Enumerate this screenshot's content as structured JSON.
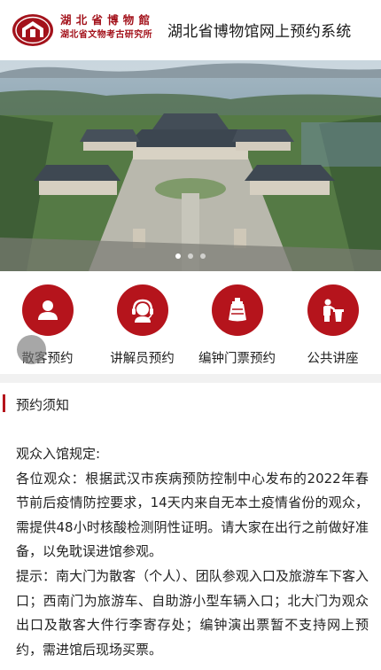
{
  "header": {
    "logo_line1": "湖北省博物館",
    "logo_line2": "湖北省文物考古研究所",
    "title": "湖北省博物馆网上预约系统"
  },
  "banner": {
    "slide_count": 3,
    "active_slide": 1
  },
  "menu": {
    "items": [
      {
        "label": "散客预约",
        "icon": "person-icon"
      },
      {
        "label": "讲解员预约",
        "icon": "headset-guide-icon"
      },
      {
        "label": "编钟门票预约",
        "icon": "bronze-bell-icon"
      },
      {
        "label": "公共讲座",
        "icon": "lecture-podium-icon"
      }
    ]
  },
  "notice": {
    "title": "预约须知",
    "heading": "观众入馆规定:",
    "paragraph1": "各位观众：根据武汉市疾病预防控制中心发布的2022年春节前后疫情防控要求，14天内来自无本土疫情省份的观众，需提供48小时核酸检测阴性证明。请大家在出行之前做好准备，以免耽误进馆参观。",
    "paragraph2": "提示：南大门为散客（个人）、团队参观入口及旅游车下客入口；西南门为旅游车、自助游小型车辆入口；北大门为观众出口及散客大件行李寄存处；编钟演出票暂不支持网上预约，需进馆后现场买票。"
  },
  "colors": {
    "brand_red": "#b5141c",
    "logo_red": "#a3121b"
  }
}
